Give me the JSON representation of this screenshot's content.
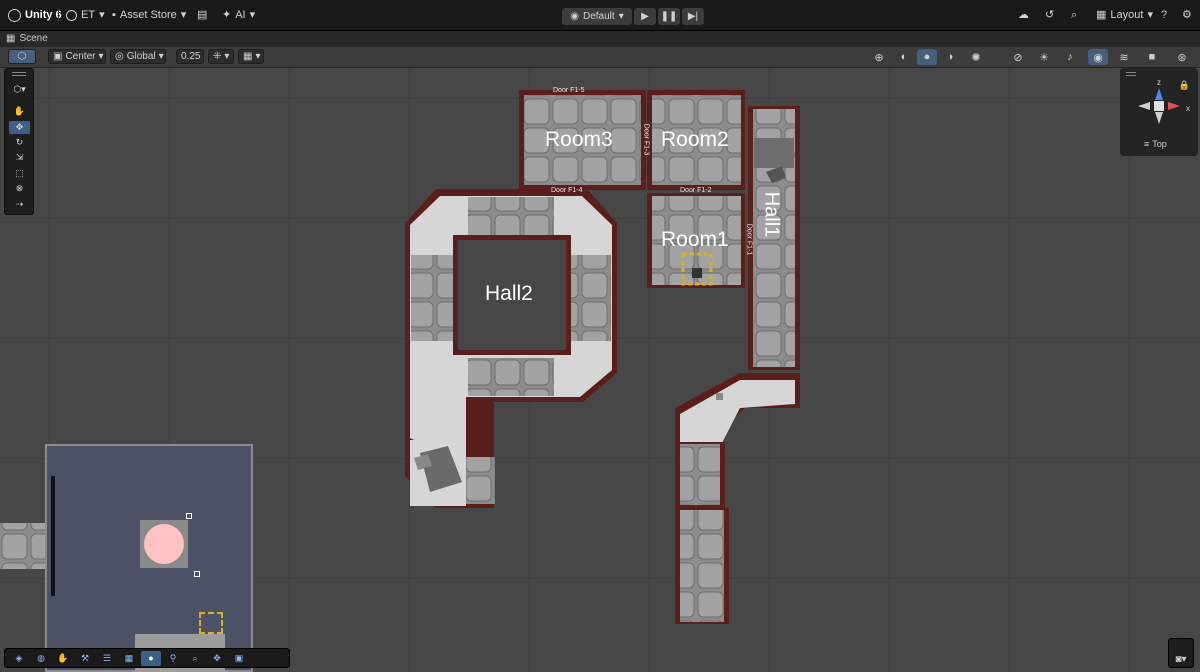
{
  "topbar": {
    "unity_label": "Unity 6",
    "account_label": "ET",
    "asset_store_label": "Asset Store",
    "ai_label": "AI",
    "play_mode_label": "Default",
    "layout_label": "Layout"
  },
  "tabbar": {
    "scene_tab": "Scene"
  },
  "toolbar": {
    "pivot_label": "Center",
    "space_label": "Global",
    "snap_value": "0.25"
  },
  "scene": {
    "rooms": {
      "room3": "Room3",
      "room2": "Room2",
      "room1": "Room1",
      "hall1": "Hall1",
      "hall2": "Hall2"
    },
    "doors": {
      "f1_5": "Door F1-5",
      "f1_3": "Door F1-3",
      "f1_4": "Door F1-4",
      "f1_2": "Door F1-2",
      "f1_1": "Door F1-1"
    }
  },
  "gizmo": {
    "view_label": "Top",
    "z_label": "z",
    "x_label": "x"
  },
  "colors": {
    "wall": "#5a1f1d",
    "floor_tile": "#9c9c9c",
    "floor_light": "#d4d4d4",
    "grid": "#3f3f3f",
    "selected_tool": "#3e5f88"
  }
}
